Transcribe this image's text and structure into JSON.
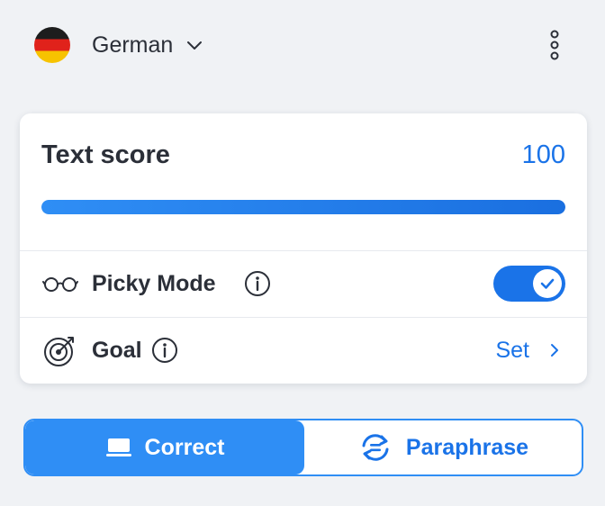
{
  "header": {
    "language": "German",
    "flag_icon": "germany-flag",
    "chevron_icon": "chevron-down-icon",
    "menu_icon": "kebab-menu-icon"
  },
  "score": {
    "title": "Text score",
    "value": "100",
    "progress_fraction": 1.0
  },
  "options": {
    "picky_mode": {
      "label": "Picky Mode",
      "icon": "glasses-icon",
      "info_icon": "info-icon",
      "enabled": true
    },
    "goal": {
      "label": "Goal",
      "icon": "target-icon",
      "info_icon": "info-icon",
      "action_label": "Set",
      "action_icon": "chevron-right-icon"
    }
  },
  "mode_tabs": [
    {
      "label": "Correct",
      "icon": "laptop-icon",
      "active": true
    },
    {
      "label": "Paraphrase",
      "icon": "rephrase-icon",
      "active": false
    }
  ],
  "colors": {
    "accent": "#1a73e8",
    "segment_active": "#2f8ef5",
    "background": "#f0f2f5"
  }
}
